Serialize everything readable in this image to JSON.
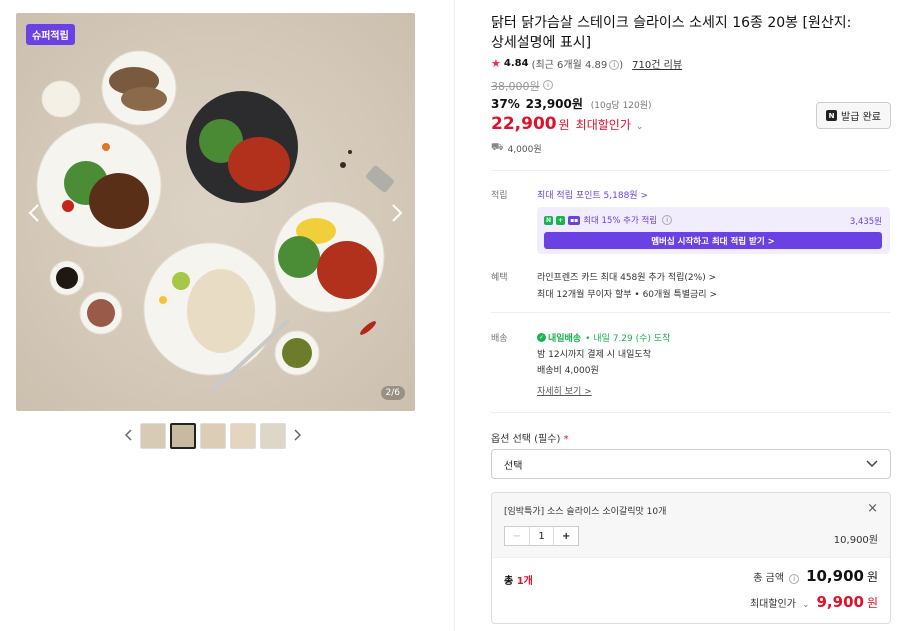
{
  "gallery": {
    "badge": "슈퍼적립",
    "counter": "2/6",
    "prev_icon": "chevron-left-icon",
    "next_icon": "chevron-right-icon",
    "thumb_count": 5,
    "active_thumb": 2
  },
  "product": {
    "title": "닭터 닭가슴살 스테이크 슬라이스 소세지 16종 20봉 [원산지: 상세설명에 표시]",
    "rating": "4.84",
    "recent_rating": "(최근 6개월 4.89",
    "reviews": "710건 리뷰",
    "original_price": "38,000원",
    "discount_pct": "37%",
    "sale_price": "23,900원",
    "unit_price": "(10g당 120원)",
    "max_discount_price": "22,900",
    "max_discount_won": "원",
    "max_discount_label": "최대할인가",
    "coupon_button": "발급 완료",
    "shipping_fee": "4,000원"
  },
  "points": {
    "label": "적립",
    "main": "최대 적립 포인트 5,188원 >",
    "extra_text": "최대 15% 추가 적립",
    "extra_amount": "3,435원",
    "membership_button": "멤버십 시작하고 최대 적립 받기 >"
  },
  "benefit": {
    "label": "혜택",
    "line1": "라인프렌즈 카드 최대 458원 추가 적립(2%) >",
    "line2": "최대 12개월 무이자 할부 • 60개월 특별금리 >"
  },
  "delivery": {
    "label": "배송",
    "badge": "내일배송",
    "date": "• 내일 7.29 (수) 도착",
    "line2": "밤 12시까지 결제 시 내일도착",
    "line3": "배송비 4,000원",
    "more": "자세히 보기 >"
  },
  "options": {
    "label": "옵션 선택 (필수)",
    "required_mark": "*",
    "select_placeholder": "선택"
  },
  "selected_item": {
    "name": "[임박특가] 소스 슬라이스 소이갈릭맛 10개",
    "quantity": "1",
    "price": "10,900원"
  },
  "total": {
    "label": "총 ",
    "count": "1개",
    "amount_label": "총 금액",
    "amount": "10,900",
    "won": "원",
    "max_label": "최대할인가",
    "max_amount": "9,900",
    "max_won": "원"
  },
  "colors": {
    "accent_purple": "#6a41e3",
    "price_red": "#e0112b",
    "delivery_green": "#19b44f"
  }
}
